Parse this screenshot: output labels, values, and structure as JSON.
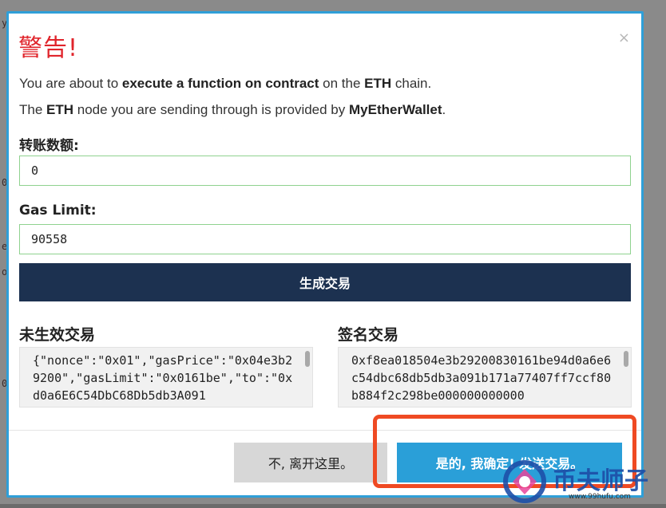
{
  "modal": {
    "title": "警告!",
    "close_symbol": "×",
    "line1": {
      "p1": "You are about to ",
      "b1": "execute a function on contract",
      "p2": " on the ",
      "b2": "ETH",
      "p3": " chain."
    },
    "line2": {
      "p1": "The ",
      "b1": "ETH",
      "p2": " node you are sending through is provided by ",
      "b2": "MyEtherWallet",
      "p3": "."
    },
    "amount_label": "转账数额:",
    "amount_value": "0",
    "gas_label": "Gas Limit:",
    "gas_value": "90558",
    "generate_button": "生成交易",
    "raw_tx_label": "未生效交易",
    "raw_tx_value": "{\"nonce\":\"0x01\",\"gasPrice\":\"0x04e3b29200\",\"gasLimit\":\"0x0161be\",\"to\":\"0xd0a6E6C54DbC68Db5db3A091",
    "signed_tx_label": "签名交易",
    "signed_tx_value": "0xf8ea018504e3b29200830161be94d0a6e6c54dbc68db5db3a091b171a77407ff7ccf80b884f2c298be000000000000",
    "no_button": "不, 离开这里。",
    "yes_button": "是的, 我确定! 发送交易。"
  },
  "background": {
    "letters": [
      "y.",
      "0",
      "e",
      "o",
      "0"
    ]
  },
  "watermark": {
    "text": "币夫师子",
    "url": "www.99hufu.com"
  },
  "colors": {
    "accent": "#2a9fd8",
    "danger_title": "#e0242b",
    "generate_bg": "#1c3150",
    "highlight": "#ef4a23",
    "field_border": "#8fd28f"
  }
}
